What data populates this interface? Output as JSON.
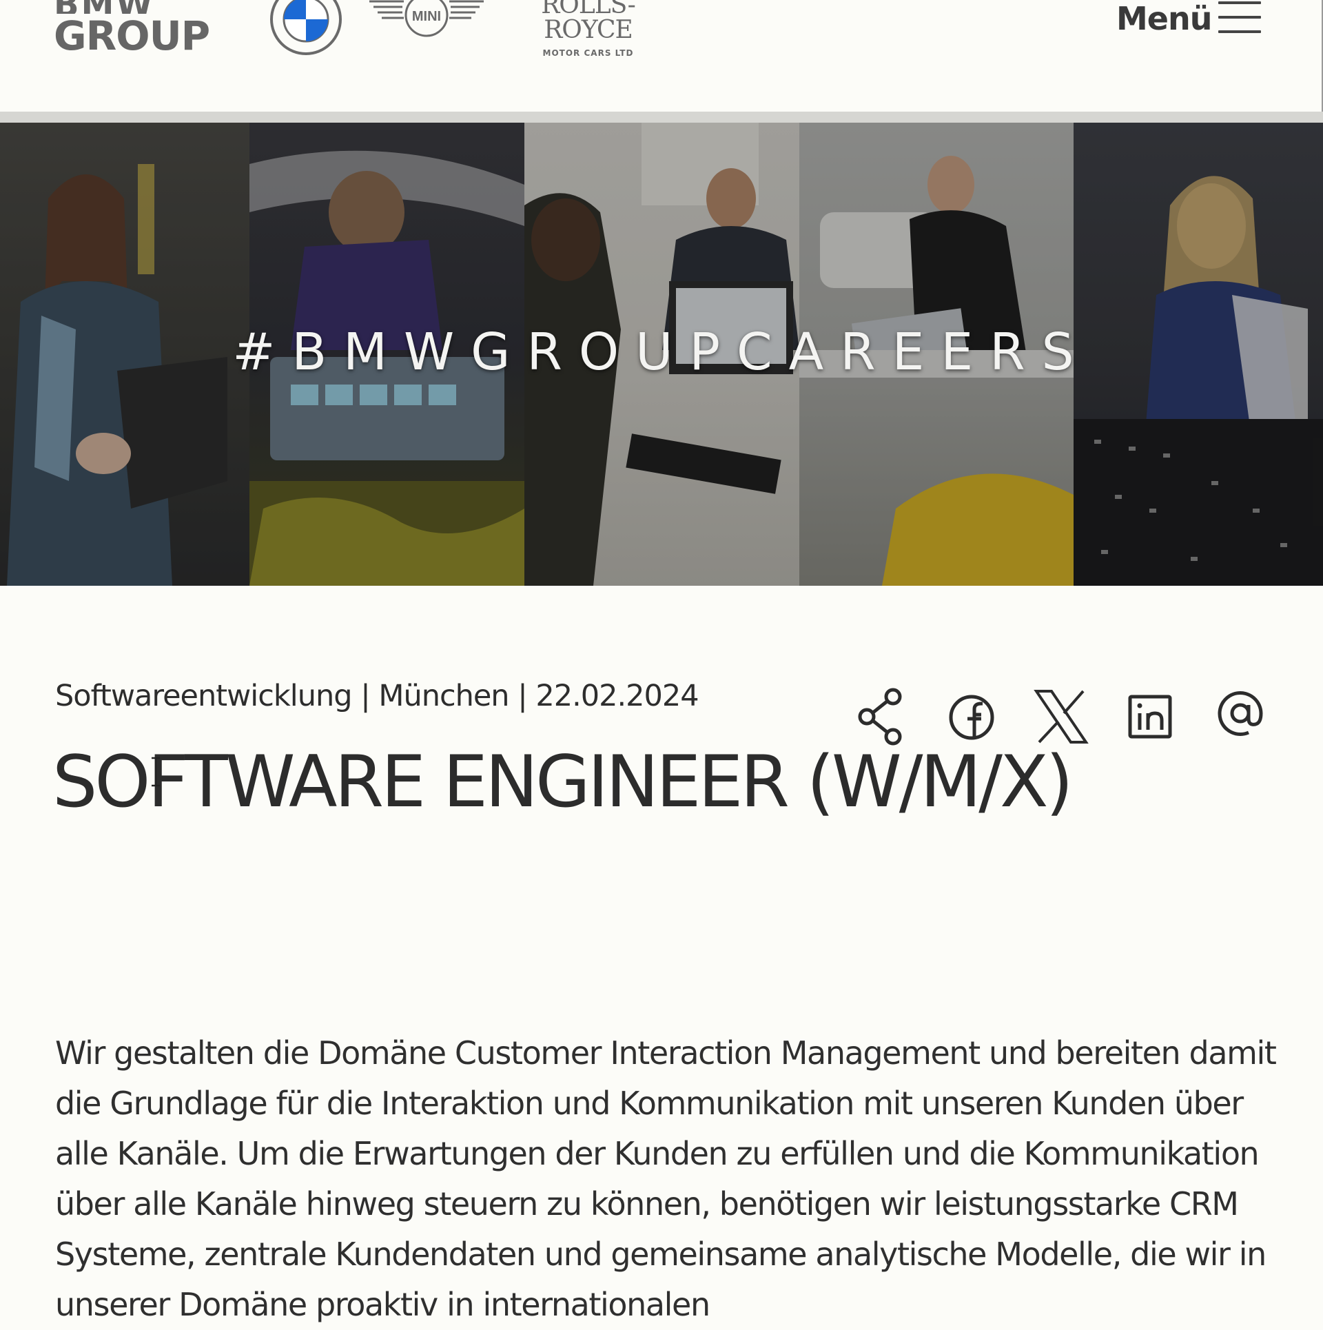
{
  "header": {
    "brand_bmw": "BMW",
    "brand_group": "GROUP",
    "mini_label": "MINI",
    "rolls_royce_name": "ROLLS-ROYCE",
    "rolls_royce_sub": "MOTOR CARS LTD",
    "menu_label": "Menü"
  },
  "hero": {
    "hashtag": "#BMWGROUPCAREERS"
  },
  "job": {
    "meta": "Softwareentwicklung | München | 22.02.2024",
    "title": "SOFTWARE ENGINEER (W/M/X)",
    "intro": "Wir gestalten die Domäne Customer Interaction Management und bereiten damit die Grundlage für die Interaktion und Kommunikation mit unseren Kunden über alle Kanäle. Um die Erwartungen der Kunden zu erfüllen und die Kommunikation über alle Kanäle hinweg steuern zu können, benötigen wir leistungsstarke CRM Systeme, zentrale Kundendaten und gemeinsame analytische Modelle, die wir in unserer Domäne proaktiv in internationalen"
  },
  "share": {
    "icons": [
      "share-icon",
      "facebook-icon",
      "x-icon",
      "linkedin-icon",
      "email-at-icon"
    ]
  },
  "colors": {
    "page_background": "#fcfcf8",
    "text": "#2c2c2c",
    "bmw_blue": "#1c69d4",
    "logo_gray": "#666666"
  }
}
